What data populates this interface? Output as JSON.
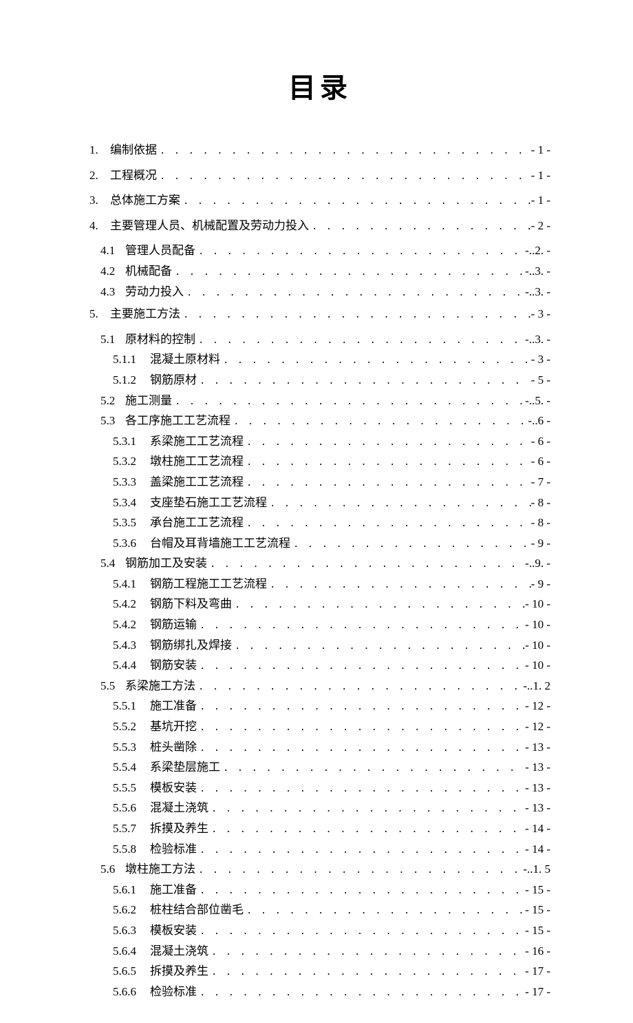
{
  "title": "目录",
  "toc": [
    {
      "level": 1,
      "num": "1.",
      "label": "编制依据",
      "page": "- 1 -"
    },
    {
      "level": 1,
      "num": "2.",
      "label": "工程概况",
      "page": "- 1 -"
    },
    {
      "level": 1,
      "num": "3.",
      "label": "总体施工方案",
      "page": "- 1 -"
    },
    {
      "level": 1,
      "num": "4.",
      "label": "主要管理人员、机械配置及劳动力投入",
      "page": "- 2 -"
    },
    {
      "level": 2,
      "num": "4.1",
      "label": "管理人员配备",
      "page": "-..2. -"
    },
    {
      "level": 2,
      "num": "4.2",
      "label": "机械配备",
      "page": "-..3. -"
    },
    {
      "level": 2,
      "num": "4.3",
      "label": "劳动力投入",
      "page": "-..3. -"
    },
    {
      "level": 1,
      "num": "5.",
      "label": "主要施工方法",
      "page": "- 3 -"
    },
    {
      "level": 2,
      "num": "5.1",
      "label": "原材料的控制",
      "page": "-..3. -"
    },
    {
      "level": 3,
      "num": "5.1.1",
      "label": "混凝土原材料",
      "page": "- 3 -"
    },
    {
      "level": 3,
      "num": "5.1.2",
      "label": "钢筋原材",
      "page": "- 5 -"
    },
    {
      "level": 2,
      "num": "5.2",
      "label": "施工测量",
      "page": "-..5. -"
    },
    {
      "level": 2,
      "num": "5.3",
      "label": "各工序施工工艺流程",
      "page": "-..6 -"
    },
    {
      "level": 3,
      "num": "5.3.1",
      "label": "系梁施工工艺流程",
      "page": "- 6 -"
    },
    {
      "level": 3,
      "num": "5.3.2",
      "label": "墩柱施工工艺流程",
      "page": "- 6 -"
    },
    {
      "level": 3,
      "num": "5.3.3",
      "label": "盖梁施工工艺流程",
      "page": "- 7 -"
    },
    {
      "level": 3,
      "num": "5.3.4",
      "label": "支座垫石施工工艺流程",
      "page": "- 8 -"
    },
    {
      "level": 3,
      "num": "5.3.5",
      "label": "承台施工工艺流程",
      "page": "- 8 -"
    },
    {
      "level": 3,
      "num": "5.3.6",
      "label": "台帽及耳背墙施工工艺流程",
      "page": "- 9 -"
    },
    {
      "level": 2,
      "num": "5.4",
      "label": "钢筋加工及安装",
      "page": "-..9. -"
    },
    {
      "level": 3,
      "num": "5.4.1",
      "label": "钢筋工程施工工艺流程",
      "page": "- 9 -"
    },
    {
      "level": 3,
      "num": "5.4.2",
      "label": "钢筋下料及弯曲",
      "page": "- 10 -"
    },
    {
      "level": 3,
      "num": "5.4.2",
      "label": "钢筋运输",
      "page": "- 10 -"
    },
    {
      "level": 3,
      "num": "5.4.3",
      "label": "钢筋绑扎及焊接",
      "page": "- 10 -"
    },
    {
      "level": 3,
      "num": "5.4.4",
      "label": "钢筋安装",
      "page": "- 10 -"
    },
    {
      "level": 2,
      "num": "5.5",
      "label": "系梁施工方法",
      "page": "-..1. 2"
    },
    {
      "level": 3,
      "num": "5.5.1",
      "label": "施工准备",
      "page": "- 12 -"
    },
    {
      "level": 3,
      "num": "5.5.2",
      "label": "基坑开挖",
      "page": "- 12 -"
    },
    {
      "level": 3,
      "num": "5.5.3",
      "label": "桩头凿除",
      "page": "- 13 -"
    },
    {
      "level": 3,
      "num": "5.5.4",
      "label": "系梁垫层施工",
      "page": "- 13 -"
    },
    {
      "level": 3,
      "num": "5.5.5",
      "label": "模板安装",
      "page": "- 13 -"
    },
    {
      "level": 3,
      "num": "5.5.6",
      "label": "混凝土浇筑",
      "page": "- 13 -"
    },
    {
      "level": 3,
      "num": "5.5.7",
      "label": "拆摸及养生",
      "page": "- 14 -"
    },
    {
      "level": 3,
      "num": "5.5.8",
      "label": "检验标准",
      "page": "- 14 -"
    },
    {
      "level": 2,
      "num": "5.6",
      "label": "墩柱施工方法",
      "page": "-..1. 5"
    },
    {
      "level": 3,
      "num": "5.6.1",
      "label": "施工准备",
      "page": "- 15 -"
    },
    {
      "level": 3,
      "num": "5.6.2",
      "label": "桩柱结合部位凿毛",
      "page": "- 15 -"
    },
    {
      "level": 3,
      "num": "5.6.3",
      "label": "模板安装",
      "page": "- 15 -"
    },
    {
      "level": 3,
      "num": "5.6.4",
      "label": "混凝土浇筑",
      "page": "- 16 -"
    },
    {
      "level": 3,
      "num": "5.6.5",
      "label": "拆摸及养生",
      "page": "- 17 -"
    },
    {
      "level": 3,
      "num": "5.6.6",
      "label": "检验标准",
      "page": "- 17 -"
    }
  ]
}
